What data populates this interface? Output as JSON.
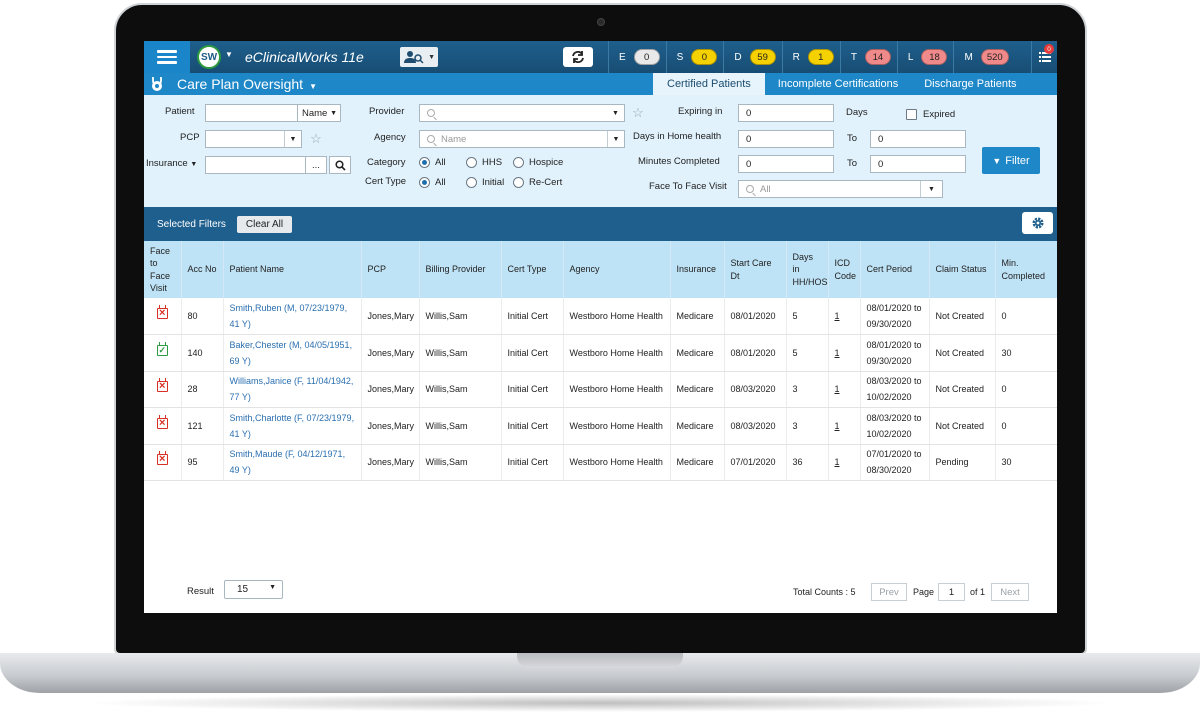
{
  "app": {
    "brand": "eClinicalWorks 11e",
    "user_initials": "SW"
  },
  "counters": [
    {
      "letter": "E",
      "count": "0",
      "color": "#e9e9e9"
    },
    {
      "letter": "S",
      "count": "0",
      "color": "#f6d100"
    },
    {
      "letter": "D",
      "count": "59",
      "color": "#f6d100"
    },
    {
      "letter": "R",
      "count": "1",
      "color": "#f6d100"
    },
    {
      "letter": "T",
      "count": "14",
      "color": "#f08a8a"
    },
    {
      "letter": "L",
      "count": "18",
      "color": "#f08a8a"
    },
    {
      "letter": "M",
      "count": "520",
      "color": "#f08a8a"
    }
  ],
  "notifications": {
    "badge": "0"
  },
  "page": {
    "title": "Care Plan Oversight"
  },
  "tabs": [
    {
      "label": "Certified Patients",
      "active": true
    },
    {
      "label": "Incomplete Certifications",
      "active": false
    },
    {
      "label": "Discharge Patients",
      "active": false
    }
  ],
  "filters": {
    "patient_label": "Patient",
    "patient_sort": "Name",
    "pcp_label": "PCP",
    "insurance_label": "Insurance",
    "insurance_more": "...",
    "provider_label": "Provider",
    "agency_label": "Agency",
    "agency_placeholder": "Name",
    "category_label": "Category",
    "category_options": [
      "All",
      "HHS",
      "Hospice"
    ],
    "cert_type_label": "Cert Type",
    "cert_type_options": [
      "All",
      "Initial",
      "Re-Cert"
    ],
    "expiring_in_label": "Expiring in",
    "expiring_in_value": "0",
    "days_label": "Days",
    "expired_label": "Expired",
    "days_home_label": "Days in Home health",
    "days_home_from": "0",
    "to_label": "To",
    "days_home_to": "0",
    "minutes_label": "Minutes Completed",
    "minutes_from": "0",
    "minutes_to": "0",
    "f2f_label": "Face To Face Visit",
    "f2f_value": "All",
    "filter_button": "Filter"
  },
  "selected_filters": {
    "label": "Selected Filters",
    "clear_all": "Clear All"
  },
  "table": {
    "columns": [
      "Face to Face Visit",
      "Acc No",
      "Patient Name",
      "PCP",
      "Billing Provider",
      "Cert Type",
      "Agency",
      "Insurance",
      "Start Care Dt",
      "Days in HH/HOS",
      "ICD Code",
      "Cert Period",
      "Claim Status",
      "Min. Completed"
    ],
    "rows": [
      {
        "f2f": "missing",
        "acc": "80",
        "name": "Smith,Ruben (M, 07/23/1979, 41 Y)",
        "pcp": "Jones,Mary",
        "billing": "Willis,Sam",
        "cert": "Initial Cert",
        "agency": "Westboro Home Health",
        "ins": "Medicare",
        "start": "08/01/2020",
        "days": "5",
        "icd": "1",
        "period": "08/01/2020 to 09/30/2020",
        "claim": "Not Created",
        "min": "0"
      },
      {
        "f2f": "done",
        "acc": "140",
        "name": "Baker,Chester (M, 04/05/1951, 69 Y)",
        "pcp": "Jones,Mary",
        "billing": "Willis,Sam",
        "cert": "Initial Cert",
        "agency": "Westboro Home Health",
        "ins": "Medicare",
        "start": "08/01/2020",
        "days": "5",
        "icd": "1",
        "period": "08/01/2020 to 09/30/2020",
        "claim": "Not Created",
        "min": "30"
      },
      {
        "f2f": "missing",
        "acc": "28",
        "name": "Williams,Janice (F, 11/04/1942, 77 Y)",
        "pcp": "Jones,Mary",
        "billing": "Willis,Sam",
        "cert": "Initial Cert",
        "agency": "Westboro Home Health",
        "ins": "Medicare",
        "start": "08/03/2020",
        "days": "3",
        "icd": "1",
        "period": "08/03/2020 to 10/02/2020",
        "claim": "Not Created",
        "min": "0"
      },
      {
        "f2f": "missing",
        "acc": "121",
        "name": "Smith,Charlotte (F, 07/23/1979, 41 Y)",
        "pcp": "Jones,Mary",
        "billing": "Willis,Sam",
        "cert": "Initial Cert",
        "agency": "Westboro Home Health",
        "ins": "Medicare",
        "start": "08/03/2020",
        "days": "3",
        "icd": "1",
        "period": "08/03/2020 to 10/02/2020",
        "claim": "Not Created",
        "min": "0"
      },
      {
        "f2f": "missing",
        "acc": "95",
        "name": "Smith,Maude (F, 04/12/1971, 49 Y)",
        "pcp": "Jones,Mary",
        "billing": "Willis,Sam",
        "cert": "Initial Cert",
        "agency": "Westboro Home Health",
        "ins": "Medicare",
        "start": "07/01/2020",
        "days": "36",
        "icd": "1",
        "period": "07/01/2020 to 08/30/2020",
        "claim": "Pending",
        "min": "30"
      }
    ]
  },
  "footer": {
    "result_label": "Result",
    "result_value": "15",
    "total_counts": "Total Counts : 5",
    "prev": "Prev",
    "page_label": "Page",
    "page_value": "1",
    "of_label": "of 1",
    "next": "Next"
  }
}
